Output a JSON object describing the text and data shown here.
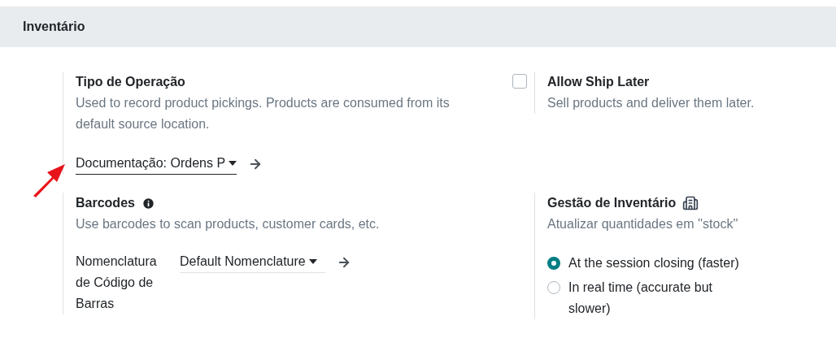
{
  "section": {
    "title": "Inventário"
  },
  "settings": [
    {
      "title": "Tipo de Operação",
      "description": "Used to record product pickings. Products are consumed from its default source location.",
      "select": {
        "value": "Documentação: Ordens P",
        "focused": true
      }
    },
    {
      "title": "Allow Ship Later",
      "description": "Sell products and deliver them later.",
      "checkbox": {
        "checked": false
      }
    },
    {
      "title": "Barcodes",
      "info_icon": true,
      "description": "Use barcodes to scan products, customer cards, etc.",
      "field_label": "Nomenclatura de Código de Barras",
      "select": {
        "value": "Default Nomenclature",
        "focused": false
      }
    },
    {
      "title": "Gestão de Inventário",
      "building_icon": true,
      "description": "Atualizar quantidades em ''stock''",
      "radios": [
        {
          "label": "At the session closing (faster)",
          "selected": true
        },
        {
          "label": "In real time (accurate but slower)",
          "selected": false
        }
      ]
    }
  ]
}
